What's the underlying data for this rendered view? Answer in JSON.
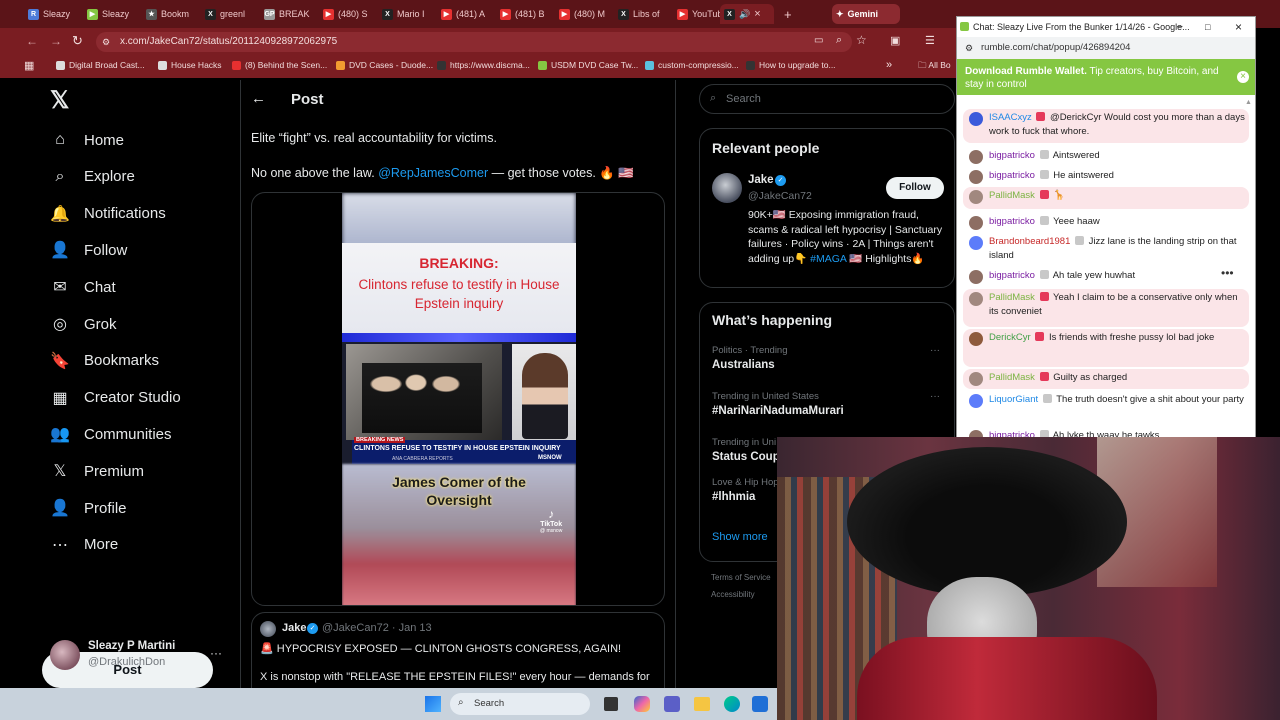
{
  "tabs": [
    {
      "label": "Sleazy",
      "color": "#4e7bd9",
      "glyph": "R"
    },
    {
      "label": "Sleazy",
      "color": "#85c742",
      "glyph": "▶"
    },
    {
      "label": "Bookm",
      "color": "#555555",
      "glyph": "★"
    },
    {
      "label": "greenl",
      "color": "#222222",
      "glyph": "X"
    },
    {
      "label": "BREAK",
      "color": "#999999",
      "glyph": "GP"
    },
    {
      "label": "(480) S",
      "color": "#e63030",
      "glyph": "▶"
    },
    {
      "label": "Mario I",
      "color": "#222222",
      "glyph": "X"
    },
    {
      "label": "(481) A",
      "color": "#e63030",
      "glyph": "▶"
    },
    {
      "label": "(481) B",
      "color": "#e63030",
      "glyph": "▶"
    },
    {
      "label": "(480) M",
      "color": "#e63030",
      "glyph": "▶"
    },
    {
      "label": "Libs of",
      "color": "#222222",
      "glyph": "X"
    },
    {
      "label": "YouTub",
      "color": "#e63030",
      "glyph": "▶"
    }
  ],
  "active_tab": {
    "label": "",
    "close": "×"
  },
  "gemini_tab": "Gemini",
  "new_tab": "+",
  "address": {
    "url": "x.com/JakeCan72/status/2011240928972062975"
  },
  "bookmarks": [
    {
      "label": "Digital Broad Cast...",
      "color": "#ddd"
    },
    {
      "label": "House Hacks",
      "color": "#ddd"
    },
    {
      "label": "(8) Behind the Scen...",
      "color": "#e63030"
    },
    {
      "label": "DVD Cases - Duode...",
      "color": "#f29b30"
    },
    {
      "label": "https://www.discma...",
      "color": "#333"
    },
    {
      "label": "USDM DVD Case Tw...",
      "color": "#85c742"
    },
    {
      "label": "custom-compressio...",
      "color": "#5bc0de"
    },
    {
      "label": "How to upgrade to...",
      "color": "#333"
    }
  ],
  "bookmarks_more": "»",
  "all_bookmarks": "All Bo",
  "nav": {
    "logo": "𝕏",
    "items": [
      {
        "label": "Home",
        "icon": "⌂"
      },
      {
        "label": "Explore",
        "icon": "⌕"
      },
      {
        "label": "Notifications",
        "icon": "🔔"
      },
      {
        "label": "Follow",
        "icon": "👤"
      },
      {
        "label": "Chat",
        "icon": "✉"
      },
      {
        "label": "Grok",
        "icon": "◎"
      },
      {
        "label": "Bookmarks",
        "icon": "🔖"
      },
      {
        "label": "Creator Studio",
        "icon": "▦"
      },
      {
        "label": "Communities",
        "icon": "👥"
      },
      {
        "label": "Premium",
        "icon": "𝕏"
      },
      {
        "label": "Profile",
        "icon": "👤"
      },
      {
        "label": "More",
        "icon": "⋯"
      }
    ],
    "post_button": "Post",
    "account_name": "Sleazy P Martini",
    "account_handle": "@DrakulichDon",
    "account_more": "···"
  },
  "post": {
    "back": "←",
    "header": "Post",
    "line1": "Elite “fight” vs. real accountability for victims.",
    "line2_pre": "No one above the law. ",
    "line2_mention": "@RepJamesComer",
    "line2_post": " — get those votes. 🔥 🇺🇸",
    "video": {
      "breaking": "BREAKING:",
      "headline": "Clintons refuse to testify in House Epstein inquiry",
      "ticker_tag": "BREAKING NEWS",
      "ticker": "CLINTONS REFUSE TO TESTIFY IN HOUSE EPSTEIN INQUIRY",
      "reporter": "ANA CABRERA REPORTS",
      "network": "MSNOW",
      "caption": "James Comer of the Oversight",
      "tiktok": "TikTok",
      "tiktok_handle": "@ msnow"
    },
    "quote": {
      "name": "Jake",
      "handle": "@JakeCan72 · Jan 13",
      "headline": "🚨 HYPOCRISY EXPOSED — CLINTON GHOSTS CONGRESS, AGAIN!",
      "body": "X is nonstop with \"RELEASE THE EPSTEIN FILES!\" every hour — demands for"
    }
  },
  "search": {
    "placeholder": "Search"
  },
  "relevant": {
    "title": "Relevant people",
    "name": "Jake",
    "handle": "@JakeCan72",
    "follow": "Follow",
    "bio_pre": "90K+🇺🇸 Exposing immigration fraud, scams & radical left hypocrisy | Sanctuary failures · Policy wins · 2A | Things aren't adding up👇 ",
    "bio_tag": "#MAGA",
    "bio_post": " 🇺🇸 Highlights🔥"
  },
  "happening": {
    "title": "What’s happening",
    "items": [
      {
        "meta": "Politics · Trending",
        "topic": "Australians"
      },
      {
        "meta": "Trending in United States",
        "topic": "#NariNariNadumaMurari"
      },
      {
        "meta": "Trending in Uni",
        "topic": "Status Coup"
      },
      {
        "meta": "Love & Hip Hop",
        "topic": "#lhhmia"
      }
    ],
    "show_more": "Show more",
    "footer1": "Terms of Service",
    "footer2": "Accessibility"
  },
  "chat": {
    "title": "Chat: Sleazy Live From the Bunker 1/14/26 - Google...",
    "url": "rumble.com/chat/popup/426894204",
    "wallet_bold": "Download Rumble Wallet.",
    "wallet_rest": " Tip creators, buy Bitcoin, and stay in control",
    "messages": [
      {
        "user": "ISAACxyz",
        "ucolor": "#1e88e5",
        "text": "@DerickCyr Would cost you more than a days work to fuck that whore.",
        "hl": true,
        "av": "#3b5bdb"
      },
      {
        "user": "bigpatricko",
        "ucolor": "#7b1fa2",
        "text": "Aintswered",
        "hl": false,
        "av": "#8d6e63"
      },
      {
        "user": "bigpatricko",
        "ucolor": "#7b1fa2",
        "text": "He aintswered",
        "hl": false,
        "av": "#8d6e63"
      },
      {
        "user": "PallidMask",
        "ucolor": "#7cb342",
        "text": "🦒",
        "hl": true,
        "av": "#a1887f"
      },
      {
        "user": "bigpatricko",
        "ucolor": "#7b1fa2",
        "text": "Yeee haaw",
        "hl": false,
        "av": "#8d6e63"
      },
      {
        "user": "Brandonbeard1981",
        "ucolor": "#c62828",
        "text": "Jizz lane is the landing strip on that island",
        "hl": false,
        "av": "#5c7cfa"
      },
      {
        "user": "bigpatricko",
        "ucolor": "#7b1fa2",
        "text": "Ah tale yew huwhat",
        "hl": false,
        "av": "#8d6e63"
      },
      {
        "user": "PallidMask",
        "ucolor": "#7cb342",
        "text": "Yeah I claim to be a conservative only when its conveniet",
        "hl": true,
        "av": "#a1887f"
      },
      {
        "user": "DerickCyr",
        "ucolor": "#43a047",
        "text": "Is friends with freshe pussy lol bad joke",
        "hl": true,
        "av": "#8e5a3c"
      },
      {
        "user": "PallidMask",
        "ucolor": "#7cb342",
        "text": "Guilty as charged",
        "hl": true,
        "av": "#a1887f"
      },
      {
        "user": "LiquorGiant",
        "ucolor": "#1e88e5",
        "text": "The truth doesn't give a shit about your party",
        "hl": false,
        "av": "#5c7cfa"
      },
      {
        "user": "bigpatricko",
        "ucolor": "#7b1fa2",
        "text": "Ah lyke th waay he tawks",
        "hl": false,
        "av": "#8d6e63"
      }
    ]
  },
  "taskbar": {
    "search": "Search"
  }
}
